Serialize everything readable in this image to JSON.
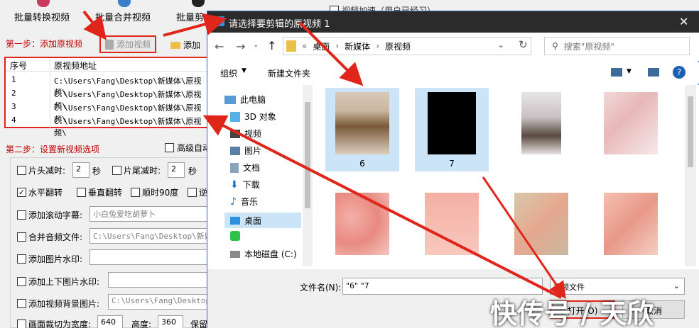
{
  "toolbar_top": {
    "btn1": "批量转换视频",
    "btn2": "批量合并视频",
    "btn3": "批量剪",
    "right_text": "视频加速（用户已经习）"
  },
  "step1": {
    "label": "第一步：添加原视频",
    "add_video": "添加视频",
    "add_folder": "添加"
  },
  "table": {
    "col_index": "序号",
    "col_path": "原视频地址",
    "rows": [
      {
        "index": "1",
        "path": "C:\\Users\\Fang\\Desktop\\新媒体\\原视频\\"
      },
      {
        "index": "2",
        "path": "C:\\Users\\Fang\\Desktop\\新媒体\\原视频\\"
      },
      {
        "index": "3",
        "path": "C:\\Users\\Fang\\Desktop\\新媒体\\原视频\\"
      },
      {
        "index": "4",
        "path": "C:\\Users\\Fang\\Desktop\\新媒体\\原视频\\"
      }
    ]
  },
  "step2": {
    "label": "第二步：设置新视频选项",
    "advanced": "高级自动"
  },
  "options": {
    "head_cut": "片头减时:",
    "head_val": "2",
    "sec": "秒",
    "tail_cut": "片尾减时:",
    "tail_val": "2",
    "sec2": "秒",
    "hflip": "水平翻转",
    "vflip": "垂直翻转",
    "rot90": "顺时90度",
    "rev": "逆",
    "scroll_sub": "添加滚动字幕:",
    "scroll_val": "小白兔爱吃胡萝卜",
    "merge_audio": "合并音频文件:",
    "merge_val": "C:\\Users\\Fang\\Desktop\\新媒体",
    "img_wm": "添加图片水印:",
    "img_wm_val": "",
    "tb_wm": "添加上下图片水印:",
    "tb_wm_val": "",
    "bg_img": "添加视频背景图片:",
    "bg_val": "C:\\Users\\Fang\\Desktop\\",
    "crop": "画面裁切为宽度:",
    "width_val": "640",
    "height_lbl": "高度:",
    "height_val": "360",
    "keep": "保留"
  },
  "dialog": {
    "title": "请选择要剪辑的原视频 1",
    "close": "✕",
    "breadcrumb": [
      "«",
      "桌面",
      "›",
      "新媒体",
      "›",
      "原视频"
    ],
    "search_placeholder": "搜索\"原视频\"",
    "organize": "组织",
    "new_folder": "新建文件夹",
    "sidebar": [
      "此电脑",
      "3D 对象",
      "视频",
      "图片",
      "文档",
      "下载",
      "音乐",
      "桌面",
      "",
      "本地磁盘 (C:)"
    ],
    "files": [
      "6",
      "7",
      "",
      "",
      "",
      "",
      "",
      ""
    ],
    "filename_label": "文件名(N):",
    "filename_value": "\"6\" \"7",
    "filetype": "视频文件",
    "open": "打开(O)",
    "cancel": "取消"
  },
  "watermark": "快传号 / 天欣",
  "colors": {
    "accent": "#0060c0",
    "red": "#e0251b",
    "title_bg": "#2b2b2b"
  }
}
